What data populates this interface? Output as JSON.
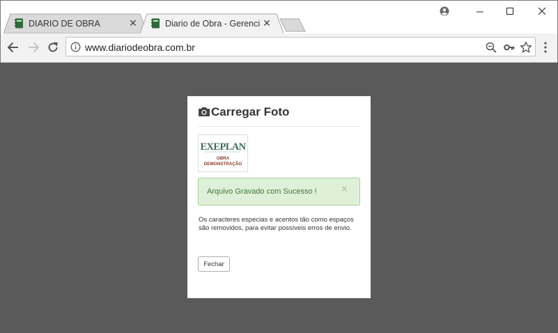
{
  "browser": {
    "tabs": [
      {
        "title": "DIARIO DE OBRA",
        "active": false
      },
      {
        "title": "Diario de Obra - Gerenciamento",
        "active": true
      }
    ],
    "address_bar": {
      "url": "www.diariodeobra.com.br"
    },
    "icons": {
      "tab_favicon": "notebook-icon",
      "profile": "account-icon",
      "back": "arrow-left-icon",
      "forward": "arrow-right-icon",
      "reload": "reload-icon",
      "site_info": "info-icon",
      "zoom": "zoom-out-icon",
      "passwords": "key-icon",
      "bookmark": "star-icon",
      "menu": "kebab-menu-icon"
    },
    "colors": {
      "tabstrip": "#ffffff",
      "toolbar": "#f2f2f2",
      "page_backdrop": "#5a5a5a"
    }
  },
  "modal": {
    "title": "Carregar Foto",
    "title_icon": "camera-icon",
    "photo": {
      "logo_text": "EXEPLAN",
      "caption_line1": "OBRA",
      "caption_line2": "DEMONSTRAÇÃO"
    },
    "alert": {
      "message": "Arquivo Gravado com Sucesso !",
      "close_symbol": "×",
      "type": "success",
      "color": "#3c763d",
      "background": "#dff0d8"
    },
    "note": "Os caracteres especias e acentos tão como espaços são removidos, para evitar possíveis erros de envio.",
    "close_button_label": "Fechar"
  }
}
